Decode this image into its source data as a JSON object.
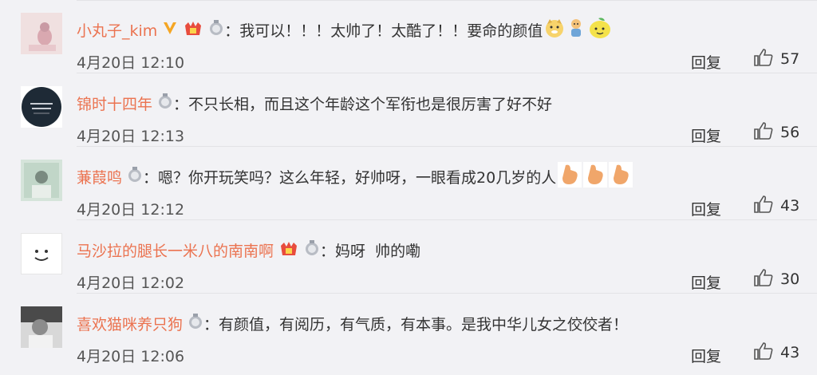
{
  "comments": [
    {
      "username": "小丸子_kim",
      "text": "：我可以！！！太帅了！太酷了！！要命的颜值",
      "time": "4月20日 12:10",
      "reply": "回复",
      "likes": "57",
      "emojis": [
        "doge",
        "face",
        "lemon"
      ],
      "avatar": "pink-figure"
    },
    {
      "username": "锦时十四年",
      "text": "：不只长相，而且这个年龄这个军衔也是很厉害了好不好",
      "time": "4月20日 12:13",
      "reply": "回复",
      "likes": "56",
      "emojis": [],
      "avatar": "dark-circle"
    },
    {
      "username": "蒹葭鸣",
      "text": "：嗯？你开玩笑吗？这么年轻，好帅呀，一眼看成20几岁的人",
      "time": "4月20日 12:12",
      "reply": "回复",
      "likes": "43",
      "emojis": [
        "hand",
        "hand",
        "hand"
      ],
      "avatar": "green-photo"
    },
    {
      "username": "马沙拉的腿长一米八的南南啊",
      "text": "：妈呀  帅的嘞",
      "time": "4月20日 12:02",
      "reply": "回复",
      "likes": "30",
      "emojis": [],
      "avatar": "smile"
    },
    {
      "username": "喜欢猫咪养只狗",
      "text": "：有颜值，有阅历，有气质，有本事。是我中华儿女之佼佼者！",
      "time": "4月20日 12:06",
      "reply": "回复",
      "likes": "43",
      "emojis": [],
      "avatar": "dark-photo"
    }
  ]
}
